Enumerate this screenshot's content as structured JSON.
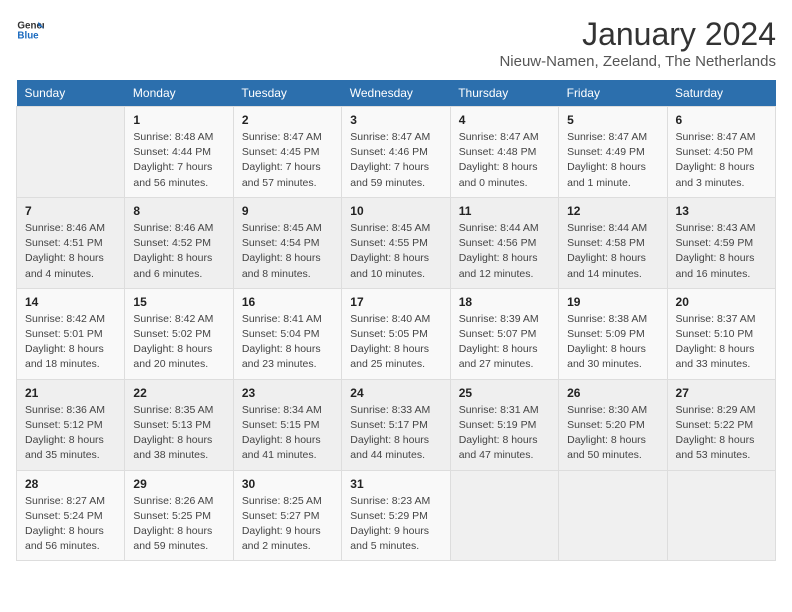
{
  "header": {
    "logo_general": "General",
    "logo_blue": "Blue",
    "month": "January 2024",
    "location": "Nieuw-Namen, Zeeland, The Netherlands"
  },
  "days_of_week": [
    "Sunday",
    "Monday",
    "Tuesday",
    "Wednesday",
    "Thursday",
    "Friday",
    "Saturday"
  ],
  "weeks": [
    [
      {
        "day": "",
        "info": ""
      },
      {
        "day": "1",
        "info": "Sunrise: 8:48 AM\nSunset: 4:44 PM\nDaylight: 7 hours\nand 56 minutes."
      },
      {
        "day": "2",
        "info": "Sunrise: 8:47 AM\nSunset: 4:45 PM\nDaylight: 7 hours\nand 57 minutes."
      },
      {
        "day": "3",
        "info": "Sunrise: 8:47 AM\nSunset: 4:46 PM\nDaylight: 7 hours\nand 59 minutes."
      },
      {
        "day": "4",
        "info": "Sunrise: 8:47 AM\nSunset: 4:48 PM\nDaylight: 8 hours\nand 0 minutes."
      },
      {
        "day": "5",
        "info": "Sunrise: 8:47 AM\nSunset: 4:49 PM\nDaylight: 8 hours\nand 1 minute."
      },
      {
        "day": "6",
        "info": "Sunrise: 8:47 AM\nSunset: 4:50 PM\nDaylight: 8 hours\nand 3 minutes."
      }
    ],
    [
      {
        "day": "7",
        "info": "Sunrise: 8:46 AM\nSunset: 4:51 PM\nDaylight: 8 hours\nand 4 minutes."
      },
      {
        "day": "8",
        "info": "Sunrise: 8:46 AM\nSunset: 4:52 PM\nDaylight: 8 hours\nand 6 minutes."
      },
      {
        "day": "9",
        "info": "Sunrise: 8:45 AM\nSunset: 4:54 PM\nDaylight: 8 hours\nand 8 minutes."
      },
      {
        "day": "10",
        "info": "Sunrise: 8:45 AM\nSunset: 4:55 PM\nDaylight: 8 hours\nand 10 minutes."
      },
      {
        "day": "11",
        "info": "Sunrise: 8:44 AM\nSunset: 4:56 PM\nDaylight: 8 hours\nand 12 minutes."
      },
      {
        "day": "12",
        "info": "Sunrise: 8:44 AM\nSunset: 4:58 PM\nDaylight: 8 hours\nand 14 minutes."
      },
      {
        "day": "13",
        "info": "Sunrise: 8:43 AM\nSunset: 4:59 PM\nDaylight: 8 hours\nand 16 minutes."
      }
    ],
    [
      {
        "day": "14",
        "info": "Sunrise: 8:42 AM\nSunset: 5:01 PM\nDaylight: 8 hours\nand 18 minutes."
      },
      {
        "day": "15",
        "info": "Sunrise: 8:42 AM\nSunset: 5:02 PM\nDaylight: 8 hours\nand 20 minutes."
      },
      {
        "day": "16",
        "info": "Sunrise: 8:41 AM\nSunset: 5:04 PM\nDaylight: 8 hours\nand 23 minutes."
      },
      {
        "day": "17",
        "info": "Sunrise: 8:40 AM\nSunset: 5:05 PM\nDaylight: 8 hours\nand 25 minutes."
      },
      {
        "day": "18",
        "info": "Sunrise: 8:39 AM\nSunset: 5:07 PM\nDaylight: 8 hours\nand 27 minutes."
      },
      {
        "day": "19",
        "info": "Sunrise: 8:38 AM\nSunset: 5:09 PM\nDaylight: 8 hours\nand 30 minutes."
      },
      {
        "day": "20",
        "info": "Sunrise: 8:37 AM\nSunset: 5:10 PM\nDaylight: 8 hours\nand 33 minutes."
      }
    ],
    [
      {
        "day": "21",
        "info": "Sunrise: 8:36 AM\nSunset: 5:12 PM\nDaylight: 8 hours\nand 35 minutes."
      },
      {
        "day": "22",
        "info": "Sunrise: 8:35 AM\nSunset: 5:13 PM\nDaylight: 8 hours\nand 38 minutes."
      },
      {
        "day": "23",
        "info": "Sunrise: 8:34 AM\nSunset: 5:15 PM\nDaylight: 8 hours\nand 41 minutes."
      },
      {
        "day": "24",
        "info": "Sunrise: 8:33 AM\nSunset: 5:17 PM\nDaylight: 8 hours\nand 44 minutes."
      },
      {
        "day": "25",
        "info": "Sunrise: 8:31 AM\nSunset: 5:19 PM\nDaylight: 8 hours\nand 47 minutes."
      },
      {
        "day": "26",
        "info": "Sunrise: 8:30 AM\nSunset: 5:20 PM\nDaylight: 8 hours\nand 50 minutes."
      },
      {
        "day": "27",
        "info": "Sunrise: 8:29 AM\nSunset: 5:22 PM\nDaylight: 8 hours\nand 53 minutes."
      }
    ],
    [
      {
        "day": "28",
        "info": "Sunrise: 8:27 AM\nSunset: 5:24 PM\nDaylight: 8 hours\nand 56 minutes."
      },
      {
        "day": "29",
        "info": "Sunrise: 8:26 AM\nSunset: 5:25 PM\nDaylight: 8 hours\nand 59 minutes."
      },
      {
        "day": "30",
        "info": "Sunrise: 8:25 AM\nSunset: 5:27 PM\nDaylight: 9 hours\nand 2 minutes."
      },
      {
        "day": "31",
        "info": "Sunrise: 8:23 AM\nSunset: 5:29 PM\nDaylight: 9 hours\nand 5 minutes."
      },
      {
        "day": "",
        "info": ""
      },
      {
        "day": "",
        "info": ""
      },
      {
        "day": "",
        "info": ""
      }
    ]
  ]
}
